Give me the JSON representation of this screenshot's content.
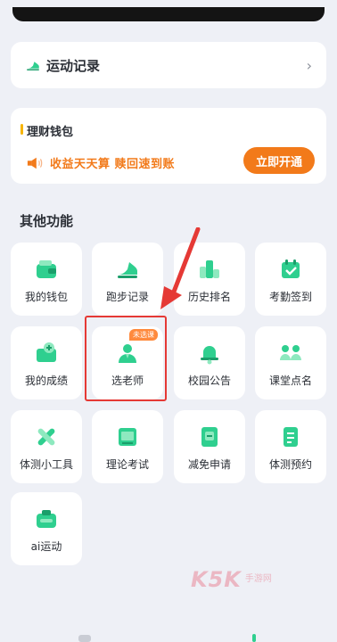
{
  "record_card": {
    "title": "运动记录",
    "chevron": "›"
  },
  "wallet": {
    "title": "理财钱包",
    "promo": "收益天天算  赎回速到账",
    "open_button": "立即开通"
  },
  "other_functions": {
    "title": "其他功能",
    "items": [
      {
        "label": "我的钱包",
        "icon": "wallet-icon"
      },
      {
        "label": "跑步记录",
        "icon": "running-shoe-icon"
      },
      {
        "label": "历史排名",
        "icon": "ranking-icon"
      },
      {
        "label": "考勤签到",
        "icon": "checkin-icon"
      },
      {
        "label": "我的成绩",
        "icon": "grades-icon"
      },
      {
        "label": "选老师",
        "icon": "teacher-icon",
        "badge": "未选课"
      },
      {
        "label": "校园公告",
        "icon": "bell-icon"
      },
      {
        "label": "课堂点名",
        "icon": "rollcall-icon"
      },
      {
        "label": "体测小工具",
        "icon": "tools-icon"
      },
      {
        "label": "理论考试",
        "icon": "exam-icon"
      },
      {
        "label": "减免申请",
        "icon": "exemption-icon"
      },
      {
        "label": "体测预约",
        "icon": "booking-icon"
      },
      {
        "label": "ai运动",
        "icon": "ai-sport-icon"
      }
    ]
  },
  "watermark": {
    "main": "K5K",
    "sub": "手游网"
  },
  "colors": {
    "accent_orange": "#f27a1a",
    "accent_green": "#2fcf8f",
    "highlight_red": "#e53935"
  }
}
